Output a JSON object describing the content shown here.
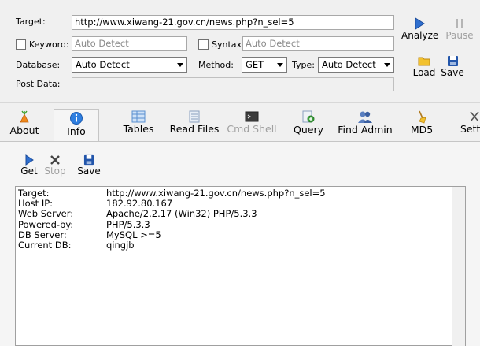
{
  "form": {
    "target_label": "Target:",
    "target_value": "http://www.xiwang-21.gov.cn/news.php?n_sel=5",
    "keyword_label": "Keyword:",
    "keyword_placeholder": "Auto Detect",
    "syntax_label": "Syntax:",
    "syntax_placeholder": "Auto Detect",
    "database_label": "Database:",
    "database_value": "Auto Detect",
    "method_label": "Method:",
    "method_value": "GET",
    "type_label": "Type:",
    "type_value": "Auto Detect",
    "postdata_label": "Post Data:",
    "postdata_value": ""
  },
  "right_buttons": {
    "analyze": "Analyze",
    "pause": "Pause",
    "load": "Load",
    "save": "Save"
  },
  "tabs": [
    {
      "label": "About",
      "icon": "carrot-icon"
    },
    {
      "label": "Info",
      "icon": "info-icon"
    },
    {
      "label": "Tables",
      "icon": "table-icon"
    },
    {
      "label": "Read Files",
      "icon": "files-icon"
    },
    {
      "label": "Cmd Shell",
      "icon": "terminal-icon"
    },
    {
      "label": "Query",
      "icon": "query-icon"
    },
    {
      "label": "Find Admin",
      "icon": "users-icon"
    },
    {
      "label": "MD5",
      "icon": "broom-icon"
    },
    {
      "label": "Setti",
      "icon": "settings-icon"
    }
  ],
  "active_tab": "Info",
  "sub_toolbar": {
    "get": "Get",
    "stop": "Stop",
    "save": "Save"
  },
  "info": [
    {
      "key": "Target:",
      "value": "http://www.xiwang-21.gov.cn/news.php?n_sel=5"
    },
    {
      "key": "Host IP:",
      "value": "182.92.80.167"
    },
    {
      "key": "Web Server:",
      "value": "Apache/2.2.17 (Win32) PHP/5.3.3"
    },
    {
      "key": "Powered-by:",
      "value": "PHP/5.3.3"
    },
    {
      "key": "DB Server:",
      "value": "MySQL >=5"
    },
    {
      "key": "Current DB:",
      "value": "qingjb"
    }
  ],
  "colors": {
    "accent": "#1f5fbf",
    "disabled_text": "#a0a0a0"
  }
}
